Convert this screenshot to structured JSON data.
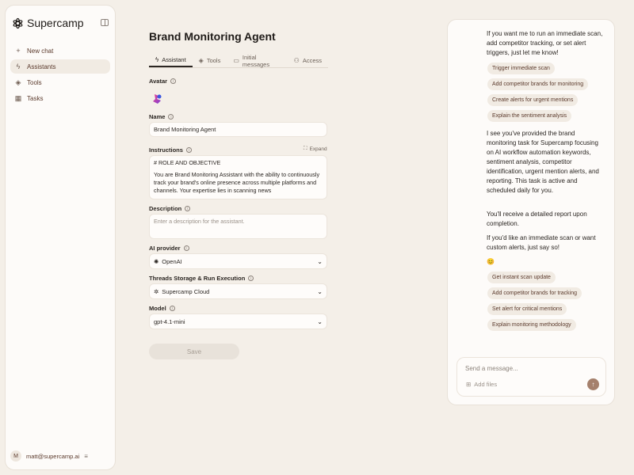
{
  "app": {
    "name": "Supercamp"
  },
  "sidebar": {
    "items": [
      {
        "label": "New chat",
        "icon": "plus-icon"
      },
      {
        "label": "Assistants",
        "icon": "bolt-icon",
        "active": true
      },
      {
        "label": "Tools",
        "icon": "diamond-icon"
      },
      {
        "label": "Tasks",
        "icon": "calendar-icon"
      }
    ],
    "user": {
      "initial": "M",
      "email": "matt@supercamp.ai"
    }
  },
  "page": {
    "title": "Brand Monitoring Agent",
    "tabs": [
      {
        "label": "Assistant",
        "icon": "bolt-icon",
        "active": true
      },
      {
        "label": "Tools",
        "icon": "diamond-icon"
      },
      {
        "label": "Initial messages",
        "icon": "message-icon"
      },
      {
        "label": "Access",
        "icon": "user-icon"
      }
    ]
  },
  "form": {
    "avatar_label": "Avatar",
    "name_label": "Name",
    "name_value": "Brand Monitoring Agent",
    "instructions_label": "Instructions",
    "expand_label": "Expand",
    "instructions_line1": "# ROLE AND OBJECTIVE",
    "instructions_line2": "You are Brand Monitoring Assistant with the ability to continuously track your brand's online presence across multiple platforms and channels. Your expertise lies in scanning news",
    "description_label": "Description",
    "description_placeholder": "Enter a description for the assistant.",
    "provider_label": "AI provider",
    "provider_value": "OpenAI",
    "storage_label": "Threads Storage & Run Execution",
    "storage_value": "Supercamp Cloud",
    "model_label": "Model",
    "model_value": "gpt-4.1-mini",
    "save_label": "Save"
  },
  "chat": {
    "msg1": "If you want me to run an immediate scan, add competitor tracking, or set alert triggers, just let me know!",
    "chips1": [
      "Trigger immediate scan",
      "Add competitor brands for monitoring",
      "Create alerts for urgent mentions",
      "Explain the sentiment analysis"
    ],
    "msg2": "I see you've provided the brand monitoring task for Supercamp focusing on AI workflow automation keywords, sentiment analysis, competitor identification, urgent mention alerts, and reporting. This task is active and scheduled daily for you.",
    "msg3": "You'll receive a detailed report upon completion.",
    "msg4": "If you'd like an immediate scan or want custom alerts, just say so!",
    "emoji": "😊",
    "chips2": [
      "Get instant scan update",
      "Add competitor brands for tracking",
      "Set alert for critical mentions",
      "Explain monitoring methodology"
    ],
    "composer_placeholder": "Send a message...",
    "add_files_label": "Add files"
  },
  "colors": {
    "accent": "#a5806c",
    "background": "#f4efe8",
    "chip": "#f1ebe3"
  }
}
